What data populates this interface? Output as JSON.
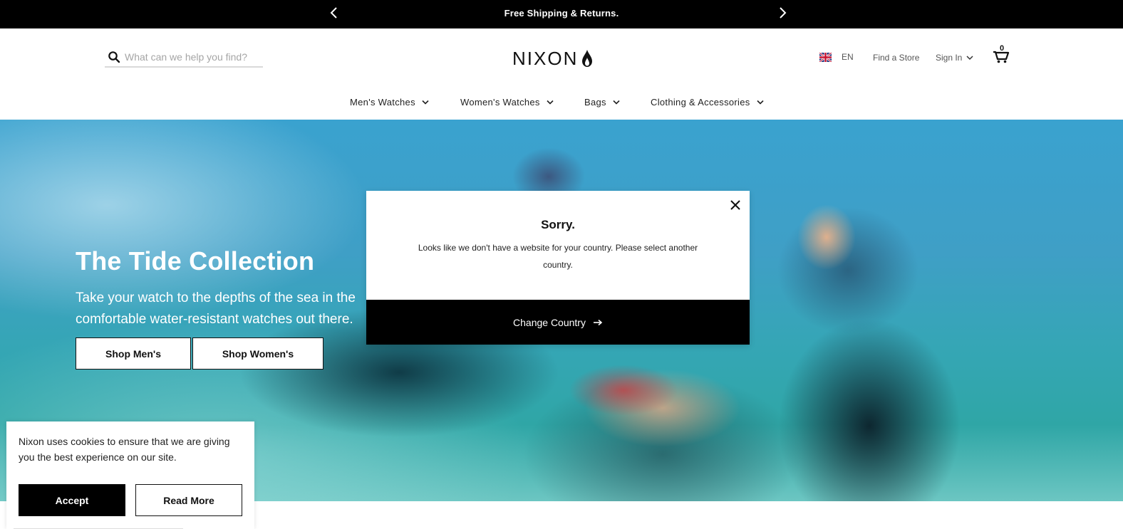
{
  "promo": {
    "message": "Free Shipping & Returns.",
    "prev_icon": "chevron-left-icon",
    "next_icon": "chevron-right-icon"
  },
  "header": {
    "search": {
      "placeholder": "What can we help you find?",
      "value": ""
    },
    "logo_text": "NIXON",
    "language": "EN",
    "find_store": "Find a Store",
    "sign_in": "Sign In",
    "cart_count": "0"
  },
  "nav": {
    "items": [
      {
        "label": "Men's Watches"
      },
      {
        "label": "Women's Watches"
      },
      {
        "label": "Bags"
      },
      {
        "label": "Clothing & Accessories"
      }
    ]
  },
  "hero": {
    "title": "The Tide Collection",
    "subtitle_line1": "Take your watch to the depths of the sea in the",
    "subtitle_line2": "comfortable water-resistant watches out there.",
    "btn_men": "Shop Men's",
    "btn_women": "Shop Women's"
  },
  "modal": {
    "heading": "Sorry.",
    "body": "Looks like we don't have a website for your country. Please select another country.",
    "cta": "Change Country"
  },
  "cookie": {
    "text": "Nixon uses cookies to ensure that we are giving you the best experience on our site.",
    "accept": "Accept",
    "read_more": "Read More"
  },
  "colors": {
    "black": "#000000",
    "white": "#ffffff",
    "muted_text": "#555555",
    "placeholder": "#a5a5a5"
  }
}
